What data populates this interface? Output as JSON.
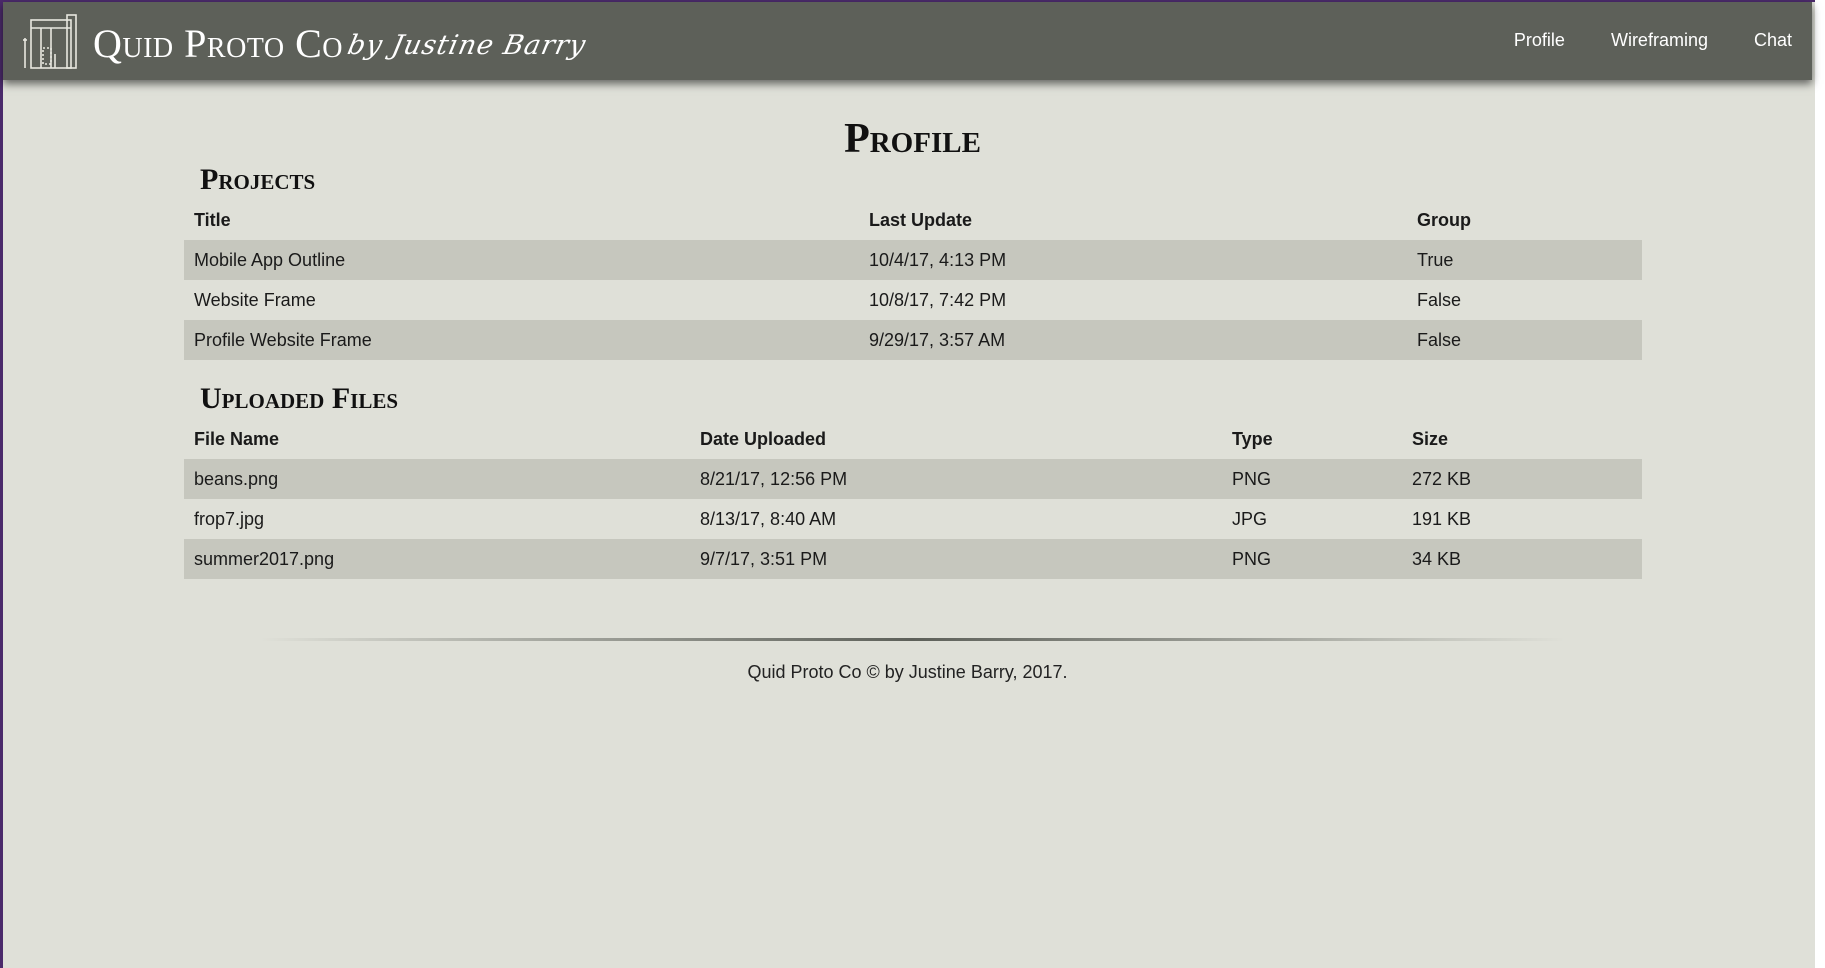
{
  "header": {
    "brand": "Quid Proto Co",
    "brand_by": "by Justine Barry",
    "nav": [
      {
        "label": "Profile"
      },
      {
        "label": "Wireframing"
      },
      {
        "label": "Chat"
      }
    ]
  },
  "page_title": "Profile",
  "projects": {
    "title": "Projects",
    "columns": [
      "Title",
      "Last Update",
      "Group"
    ],
    "rows": [
      [
        "Mobile App Outline",
        "10/4/17, 4:13 PM",
        "True"
      ],
      [
        "Website Frame",
        "10/8/17, 7:42 PM",
        "False"
      ],
      [
        "Profile Website Frame",
        "9/29/17, 3:57 AM",
        "False"
      ]
    ]
  },
  "files": {
    "title": "Uploaded Files",
    "columns": [
      "File Name",
      "Date Uploaded",
      "Type",
      "Size"
    ],
    "rows": [
      [
        "beans.png",
        "8/21/17, 12:56 PM",
        "PNG",
        "272 KB"
      ],
      [
        "frop7.jpg",
        "8/13/17, 8:40 AM",
        "JPG",
        "191 KB"
      ],
      [
        "summer2017.png",
        "9/7/17, 3:51 PM",
        "PNG",
        "34 KB"
      ]
    ]
  },
  "footer": {
    "text": "Quid Proto Co © by Justine Barry, 2017."
  },
  "colors": {
    "navbar": "#5d6059",
    "background": "#dfe0d8",
    "row_stripe": "#c6c7be"
  }
}
